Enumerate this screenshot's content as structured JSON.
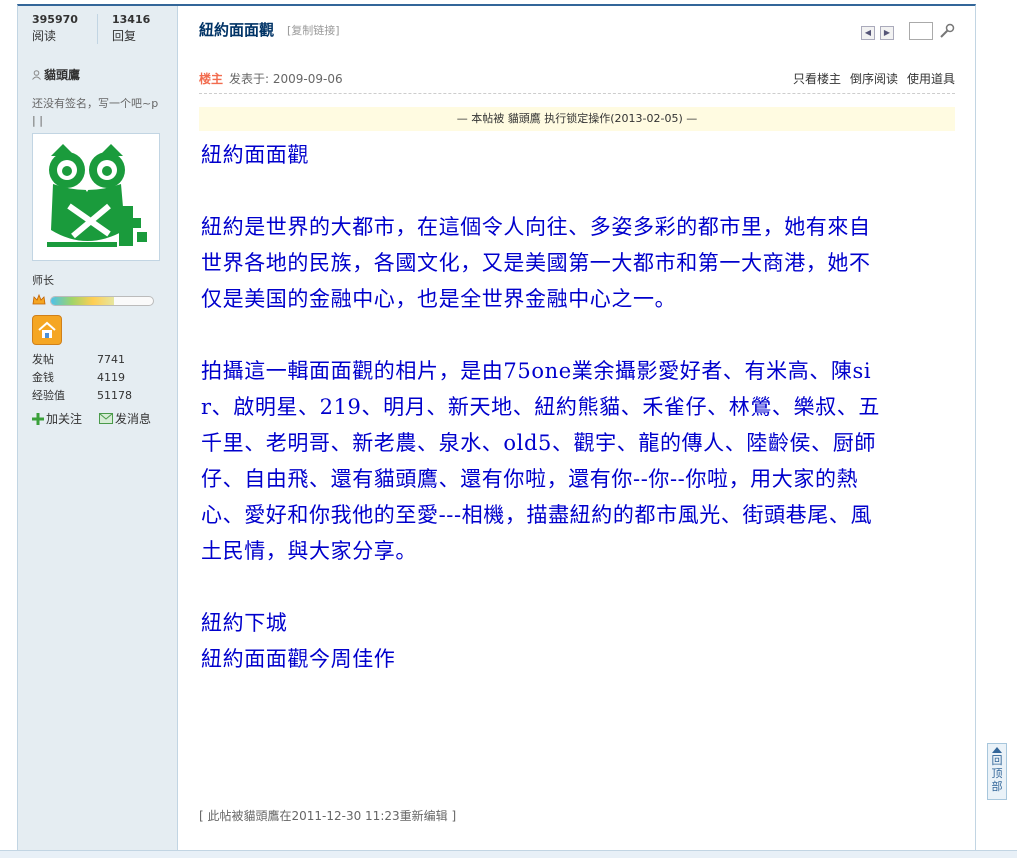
{
  "stats": {
    "reads_count": "395970",
    "reads_label": "阅读",
    "replies_count": "13416",
    "replies_label": "回复"
  },
  "thread": {
    "title": "紐約面面觀",
    "copy_link": "[复制链接]"
  },
  "user": {
    "name": "貓頭鷹",
    "signature": "还没有签名，写一个吧~p | |",
    "rank": "师长",
    "rank_progress": 0.62,
    "stats": [
      {
        "label": "发帖",
        "value": "7741"
      },
      {
        "label": "金钱",
        "value": "4119"
      },
      {
        "label": "经验值",
        "value": "51178"
      }
    ],
    "follow_label": "加关注",
    "message_label": "发消息"
  },
  "post": {
    "op_badge": "楼主",
    "posted_at": "发表于: 2009-09-06",
    "tools": [
      "只看楼主",
      "倒序阅读",
      "使用道具"
    ],
    "lock_notice": "— 本帖被 貓頭鷹 执行锁定操作(2013-02-05) —",
    "paragraphs": [
      [
        "紐約面面觀"
      ],
      [
        "紐約是世界的大都市，在這個令人向往、多姿多彩的都市里，她有來自",
        "世界各地的民族，各國文化，又是美國第一大都市和第一大商港，她不",
        "仅是美国的金融中心，也是全世界金融中心之一。"
      ],
      [
        "拍攝這一輯面面觀的相片，是由75one業余攝影愛好者、有米高、陳si",
        "r、啟明星、219、明月、新天地、紐約熊貓、禾雀仔、林鶯、樂叔、五",
        "千里、老明哥、新老農、泉水、old5、觀宇、龍的傳人、陸齡侯、厨師",
        "仔、自由飛、還有貓頭鷹、還有你啦，還有你--你--你啦，用大家的熱",
        "心、愛好和你我他的至愛---相機，描盡紐約的都市風光、街頭巷尾、風",
        "土民情，與大家分享。"
      ],
      [
        "紐約下城",
        "紐約面面觀今周佳作"
      ]
    ],
    "edited_note": "[ 此帖被貓頭鷹在2011-12-30 11:23重新编辑 ]"
  },
  "back_to_top": [
    "回",
    "顶",
    "部"
  ],
  "colors": {
    "content_text": "#0000cc",
    "header_bg": "#e5edf2",
    "border": "#c2d5e3",
    "op_badge": "#f26c4f",
    "avatar_green": "#1a9b3c"
  }
}
